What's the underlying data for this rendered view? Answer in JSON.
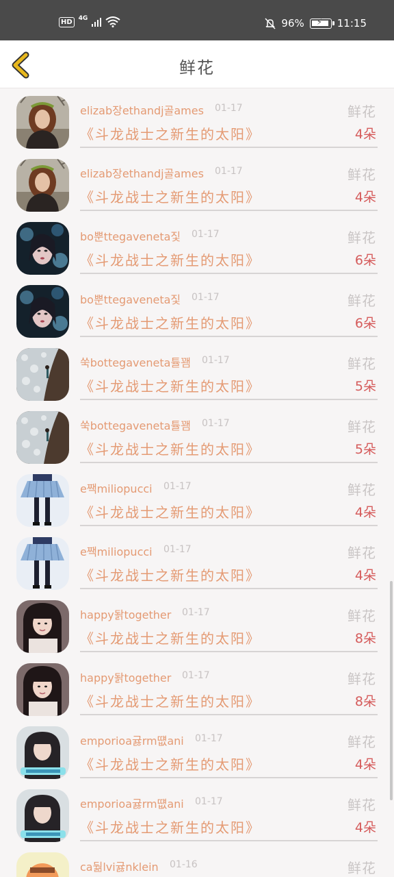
{
  "status_bar": {
    "hd": "HD",
    "network": "4G",
    "battery_pct": "96%",
    "battery_level": 0.96,
    "time": "11:15",
    "icons": [
      "signal-icon",
      "wifi-icon",
      "bell-muted-icon",
      "battery-icon"
    ]
  },
  "header": {
    "title": "鲜花",
    "back_icon": "chevron-left-icon",
    "accent": "#e8b81e"
  },
  "colors": {
    "username": "#e49a73",
    "count": "#d55b5b",
    "muted": "#c7c2c2"
  },
  "rows": [
    {
      "user": "elizab장ethandj골ames",
      "date": "01-17",
      "type": "鲜花",
      "title": "《斗龙战士之新生的太阳》",
      "count": "4朵",
      "avatar": "avatar-girl-outdoor"
    },
    {
      "user": "elizab장ethandj골ames",
      "date": "01-17",
      "type": "鲜花",
      "title": "《斗龙战士之新生的太阳》",
      "count": "4朵",
      "avatar": "avatar-girl-outdoor"
    },
    {
      "user": "bo뿐ttegaveneta짗",
      "date": "01-17",
      "type": "鲜花",
      "title": "《斗龙战士之新生的太阳》",
      "count": "6朵",
      "avatar": "avatar-painted-face"
    },
    {
      "user": "bo뿐ttegaveneta짗",
      "date": "01-17",
      "type": "鲜花",
      "title": "《斗龙战士之新生的太阳》",
      "count": "6朵",
      "avatar": "avatar-painted-face"
    },
    {
      "user": "쑥bottegaveneta튤꽴",
      "date": "01-17",
      "type": "鲜花",
      "title": "《斗龙战士之新生的太阳》",
      "count": "5朵",
      "avatar": "avatar-lace-dress"
    },
    {
      "user": "쑥bottegaveneta튤꽴",
      "date": "01-17",
      "type": "鲜花",
      "title": "《斗龙战士之新生的太阳》",
      "count": "5朵",
      "avatar": "avatar-lace-dress"
    },
    {
      "user": "e짹miliopucci",
      "date": "01-17",
      "type": "鲜花",
      "title": "《斗龙战士之新生的太阳》",
      "count": "4朵",
      "avatar": "avatar-blue-skirt"
    },
    {
      "user": "e짹miliopucci",
      "date": "01-17",
      "type": "鲜花",
      "title": "《斗龙战士之新生的太阳》",
      "count": "4朵",
      "avatar": "avatar-blue-skirt"
    },
    {
      "user": "happy돩together",
      "date": "01-17",
      "type": "鲜花",
      "title": "《斗龙战士之新生的太阳》",
      "count": "8朵",
      "avatar": "avatar-dark-hair-girl"
    },
    {
      "user": "happy돩together",
      "date": "01-17",
      "type": "鲜花",
      "title": "《斗龙战士之新生的太阳》",
      "count": "8朵",
      "avatar": "avatar-dark-hair-girl"
    },
    {
      "user": "emporioa귫rm떖ani",
      "date": "01-17",
      "type": "鲜花",
      "title": "《斗龙战士之新生的太阳》",
      "count": "4朵",
      "avatar": "avatar-girl-sticker"
    },
    {
      "user": "emporioa귫rm떖ani",
      "date": "01-17",
      "type": "鲜花",
      "title": "《斗龙战士之新生的太阳》",
      "count": "4朵",
      "avatar": "avatar-girl-sticker"
    },
    {
      "user": "ca둶lvi귫nklein",
      "date": "01-16",
      "type": "鲜花",
      "title": "",
      "count": "",
      "avatar": "avatar-cartoon"
    }
  ]
}
